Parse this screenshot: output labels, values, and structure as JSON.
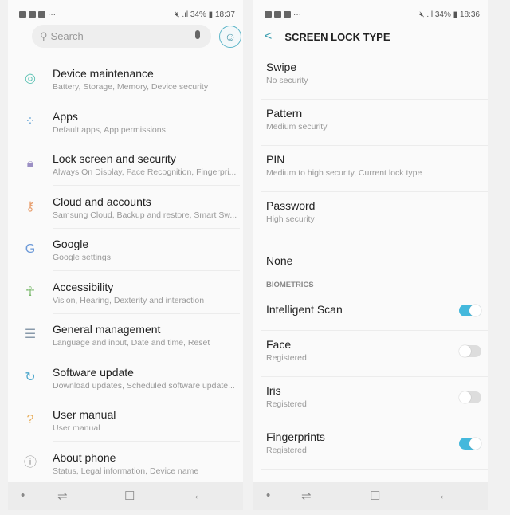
{
  "left": {
    "status": {
      "time": "18:37",
      "battery": "34%"
    },
    "search": {
      "placeholder": "Search"
    },
    "items": [
      {
        "title": "Device maintenance",
        "sub": "Battery, Storage, Memory, Device security",
        "icon": "device-maintenance-icon",
        "glyph": "◎",
        "color": "#5fc3b5"
      },
      {
        "title": "Apps",
        "sub": "Default apps, App permissions",
        "icon": "apps-icon",
        "glyph": "⁘",
        "color": "#6aa6d6"
      },
      {
        "title": "Lock screen and security",
        "sub": "Always On Display, Face Recognition, Fingerpri...",
        "icon": "lock-icon",
        "glyph": "🔒︎",
        "color": "#9b8fc4"
      },
      {
        "title": "Cloud and accounts",
        "sub": "Samsung Cloud, Backup and restore, Smart Sw...",
        "icon": "key-icon",
        "glyph": "⚷",
        "color": "#e8a070"
      },
      {
        "title": "Google",
        "sub": "Google settings",
        "icon": "google-icon",
        "glyph": "G",
        "color": "#6d9ad8"
      },
      {
        "title": "Accessibility",
        "sub": "Vision, Hearing, Dexterity and interaction",
        "icon": "accessibility-icon",
        "glyph": "☥",
        "color": "#7cba6e"
      },
      {
        "title": "General management",
        "sub": "Language and input, Date and time, Reset",
        "icon": "sliders-icon",
        "glyph": "☰",
        "color": "#8899aa"
      },
      {
        "title": "Software update",
        "sub": "Download updates, Scheduled software update...",
        "icon": "software-update-icon",
        "glyph": "↻",
        "color": "#4fa8cc"
      },
      {
        "title": "User manual",
        "sub": "User manual",
        "icon": "user-manual-icon",
        "glyph": "?",
        "color": "#e8b060"
      },
      {
        "title": "About phone",
        "sub": "Status, Legal information, Device name",
        "icon": "info-icon",
        "glyph": "ⓘ",
        "color": "#999999"
      }
    ]
  },
  "right": {
    "status": {
      "time": "18:36",
      "battery": "34%"
    },
    "title": "SCREEN LOCK TYPE",
    "options": [
      {
        "title": "Swipe",
        "sub": "No security"
      },
      {
        "title": "Pattern",
        "sub": "Medium security"
      },
      {
        "title": "PIN",
        "sub": "Medium to high security, Current lock type"
      },
      {
        "title": "Password",
        "sub": "High security"
      },
      {
        "title": "None",
        "sub": ""
      }
    ],
    "section": "BIOMETRICS",
    "biometrics": [
      {
        "title": "Intelligent Scan",
        "sub": "",
        "on": true
      },
      {
        "title": "Face",
        "sub": "Registered",
        "on": false
      },
      {
        "title": "Iris",
        "sub": "Registered",
        "on": false
      },
      {
        "title": "Fingerprints",
        "sub": "Registered",
        "on": true
      }
    ]
  },
  "accent": "#44b8dc"
}
